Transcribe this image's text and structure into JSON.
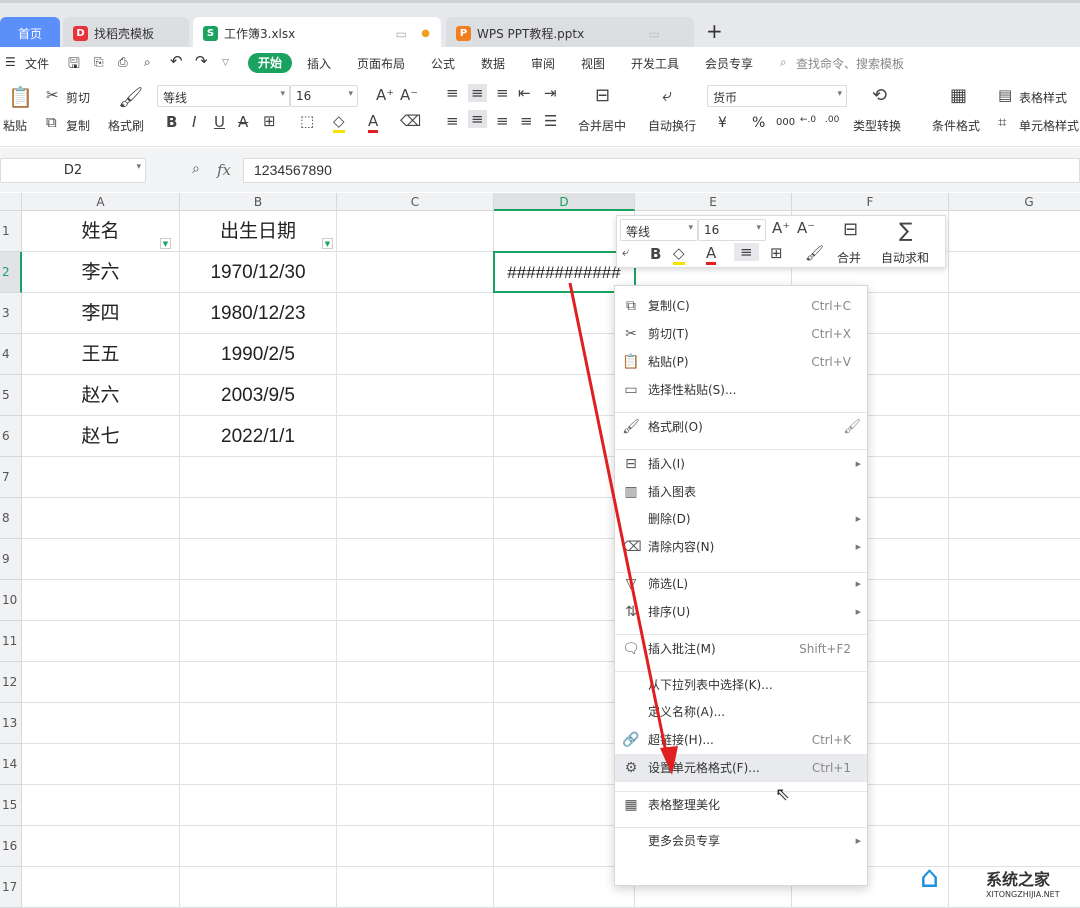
{
  "tabs": [
    {
      "label": "首页"
    },
    {
      "label": "找稻壳模板"
    },
    {
      "label": "工作簿3.xlsx"
    },
    {
      "label": "WPS PPT教程.pptx"
    }
  ],
  "new_tab": "+",
  "menu": {
    "file": "文件",
    "start": "开始",
    "items": [
      "插入",
      "页面布局",
      "公式",
      "数据",
      "审阅",
      "视图",
      "开发工具",
      "会员专享"
    ],
    "search_placeholder": "查找命令、搜索模板"
  },
  "ribbon": {
    "paste": "粘贴",
    "cut": "剪切",
    "copy": "复制",
    "format_painter": "格式刷",
    "font": "等线",
    "size": "16",
    "merge": "合并居中",
    "wrap": "自动换行",
    "number_format": "货币",
    "currency": "¥",
    "percent": "%",
    "type_convert": "类型转换",
    "cond_format": "条件格式",
    "table_style": "表格样式",
    "cell_style": "单元格样式"
  },
  "formula": {
    "cell_ref": "D2",
    "fx": "fx",
    "value": "1234567890"
  },
  "columns": [
    "A",
    "B",
    "C",
    "D",
    "E",
    "F",
    "G"
  ],
  "rows": [
    {
      "n": "1",
      "a": "姓名",
      "b": "出生日期",
      "d": ""
    },
    {
      "n": "2",
      "a": "李六",
      "b": "1970/12/30",
      "d": "############"
    },
    {
      "n": "3",
      "a": "李四",
      "b": "1980/12/23",
      "d": ""
    },
    {
      "n": "4",
      "a": "王五",
      "b": "1990/2/5",
      "d": ""
    },
    {
      "n": "5",
      "a": "赵六",
      "b": "2003/9/5",
      "d": ""
    },
    {
      "n": "6",
      "a": "赵七",
      "b": "2022/1/1",
      "d": ""
    },
    {
      "n": "7",
      "a": "",
      "b": "",
      "d": ""
    },
    {
      "n": "8",
      "a": "",
      "b": "",
      "d": ""
    },
    {
      "n": "9",
      "a": "",
      "b": "",
      "d": ""
    },
    {
      "n": "10",
      "a": "",
      "b": "",
      "d": ""
    },
    {
      "n": "11",
      "a": "",
      "b": "",
      "d": ""
    },
    {
      "n": "12",
      "a": "",
      "b": "",
      "d": ""
    },
    {
      "n": "13",
      "a": "",
      "b": "",
      "d": ""
    },
    {
      "n": "14",
      "a": "",
      "b": "",
      "d": ""
    },
    {
      "n": "15",
      "a": "",
      "b": "",
      "d": ""
    },
    {
      "n": "16",
      "a": "",
      "b": "",
      "d": ""
    },
    {
      "n": "17",
      "a": "",
      "b": "",
      "d": ""
    }
  ],
  "mini": {
    "font": "等线",
    "size": "16",
    "merge": "合并",
    "autosum": "自动求和"
  },
  "context_menu": [
    {
      "label": "复制(C)",
      "shortcut": "Ctrl+C",
      "icon": "copy-icon",
      "g": "⧉"
    },
    {
      "label": "剪切(T)",
      "shortcut": "Ctrl+X",
      "icon": "scissors-icon",
      "g": "✂"
    },
    {
      "label": "粘贴(P)",
      "shortcut": "Ctrl+V",
      "icon": "paste-icon",
      "g": "📋"
    },
    {
      "label": "选择性粘贴(S)...",
      "shortcut": "",
      "icon": "paste-special-icon",
      "g": "▭"
    },
    {
      "label": "格式刷(O)",
      "shortcut": "",
      "icon": "brush-icon",
      "g": "🖌"
    },
    {
      "label": "插入(I)",
      "shortcut": "",
      "icon": "insert-icon",
      "g": "⊟",
      "sub": true
    },
    {
      "label": "插入图表",
      "shortcut": "",
      "icon": "chart-icon",
      "g": "▥"
    },
    {
      "label": "删除(D)",
      "shortcut": "",
      "icon": "",
      "g": "",
      "sub": true
    },
    {
      "label": "清除内容(N)",
      "shortcut": "",
      "icon": "eraser-icon",
      "g": "⌫",
      "sub": true
    },
    {
      "label": "筛选(L)",
      "shortcut": "",
      "icon": "filter-icon",
      "g": "▽",
      "sub": true
    },
    {
      "label": "排序(U)",
      "shortcut": "",
      "icon": "sort-icon",
      "g": "⇅",
      "sub": true
    },
    {
      "label": "插入批注(M)",
      "shortcut": "Shift+F2",
      "icon": "comment-icon",
      "g": "🗨"
    },
    {
      "label": "从下拉列表中选择(K)...",
      "shortcut": "",
      "icon": "",
      "g": ""
    },
    {
      "label": "定义名称(A)...",
      "shortcut": "",
      "icon": "",
      "g": ""
    },
    {
      "label": "超链接(H)...",
      "shortcut": "Ctrl+K",
      "icon": "link-icon",
      "g": "🔗"
    },
    {
      "label": "设置单元格格式(F)...",
      "shortcut": "Ctrl+1",
      "icon": "format-cells-icon",
      "g": "⚙"
    },
    {
      "label": "表格整理美化",
      "shortcut": "",
      "icon": "table-beautify-icon",
      "g": "▦"
    },
    {
      "label": "更多会员专享",
      "shortcut": "",
      "icon": "",
      "g": "",
      "sub": true
    }
  ],
  "watermark": {
    "name": "系统之家",
    "url": "XITONGZHIJIA.NET"
  },
  "colors": {
    "accent": "#1aa260",
    "home_tab": "#5b8ff9",
    "arrow": "#e02020"
  }
}
